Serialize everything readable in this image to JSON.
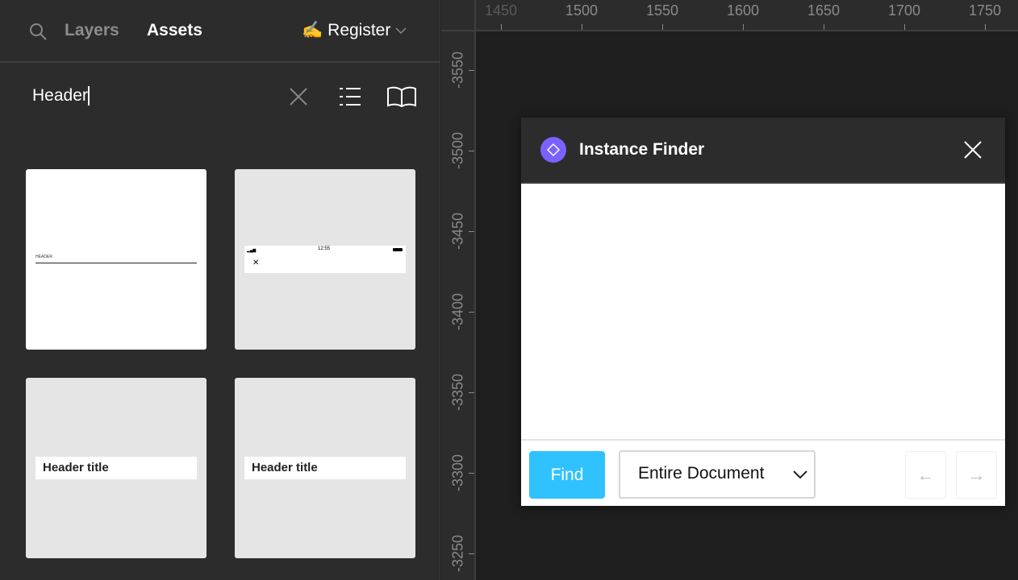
{
  "sidebar": {
    "tabs": {
      "layers": "Layers",
      "assets": "Assets"
    },
    "library": {
      "emoji": "✍️",
      "name": "Register"
    },
    "search": {
      "value": "Header"
    },
    "assets": [
      {
        "thumb_text": "HEADER",
        "kind": "line-header"
      },
      {
        "thumb_text": "12:55",
        "kind": "status-bar-header"
      },
      {
        "thumb_text": "Header title",
        "kind": "title-header"
      },
      {
        "thumb_text": "Header title",
        "kind": "title-header"
      }
    ]
  },
  "ruler": {
    "x_ticks": [
      "1450",
      "1500",
      "1550",
      "1600",
      "1650",
      "1700",
      "1750"
    ],
    "y_ticks": [
      "-3550",
      "-3500",
      "-3450",
      "-3400",
      "-3350",
      "-3300",
      "-3250"
    ]
  },
  "dialog": {
    "title": "Instance Finder",
    "icon_color": "#7b61ff",
    "find_label": "Find",
    "find_color": "#30c2ff",
    "scope": "Entire Document",
    "prev": "←",
    "next": "→"
  }
}
